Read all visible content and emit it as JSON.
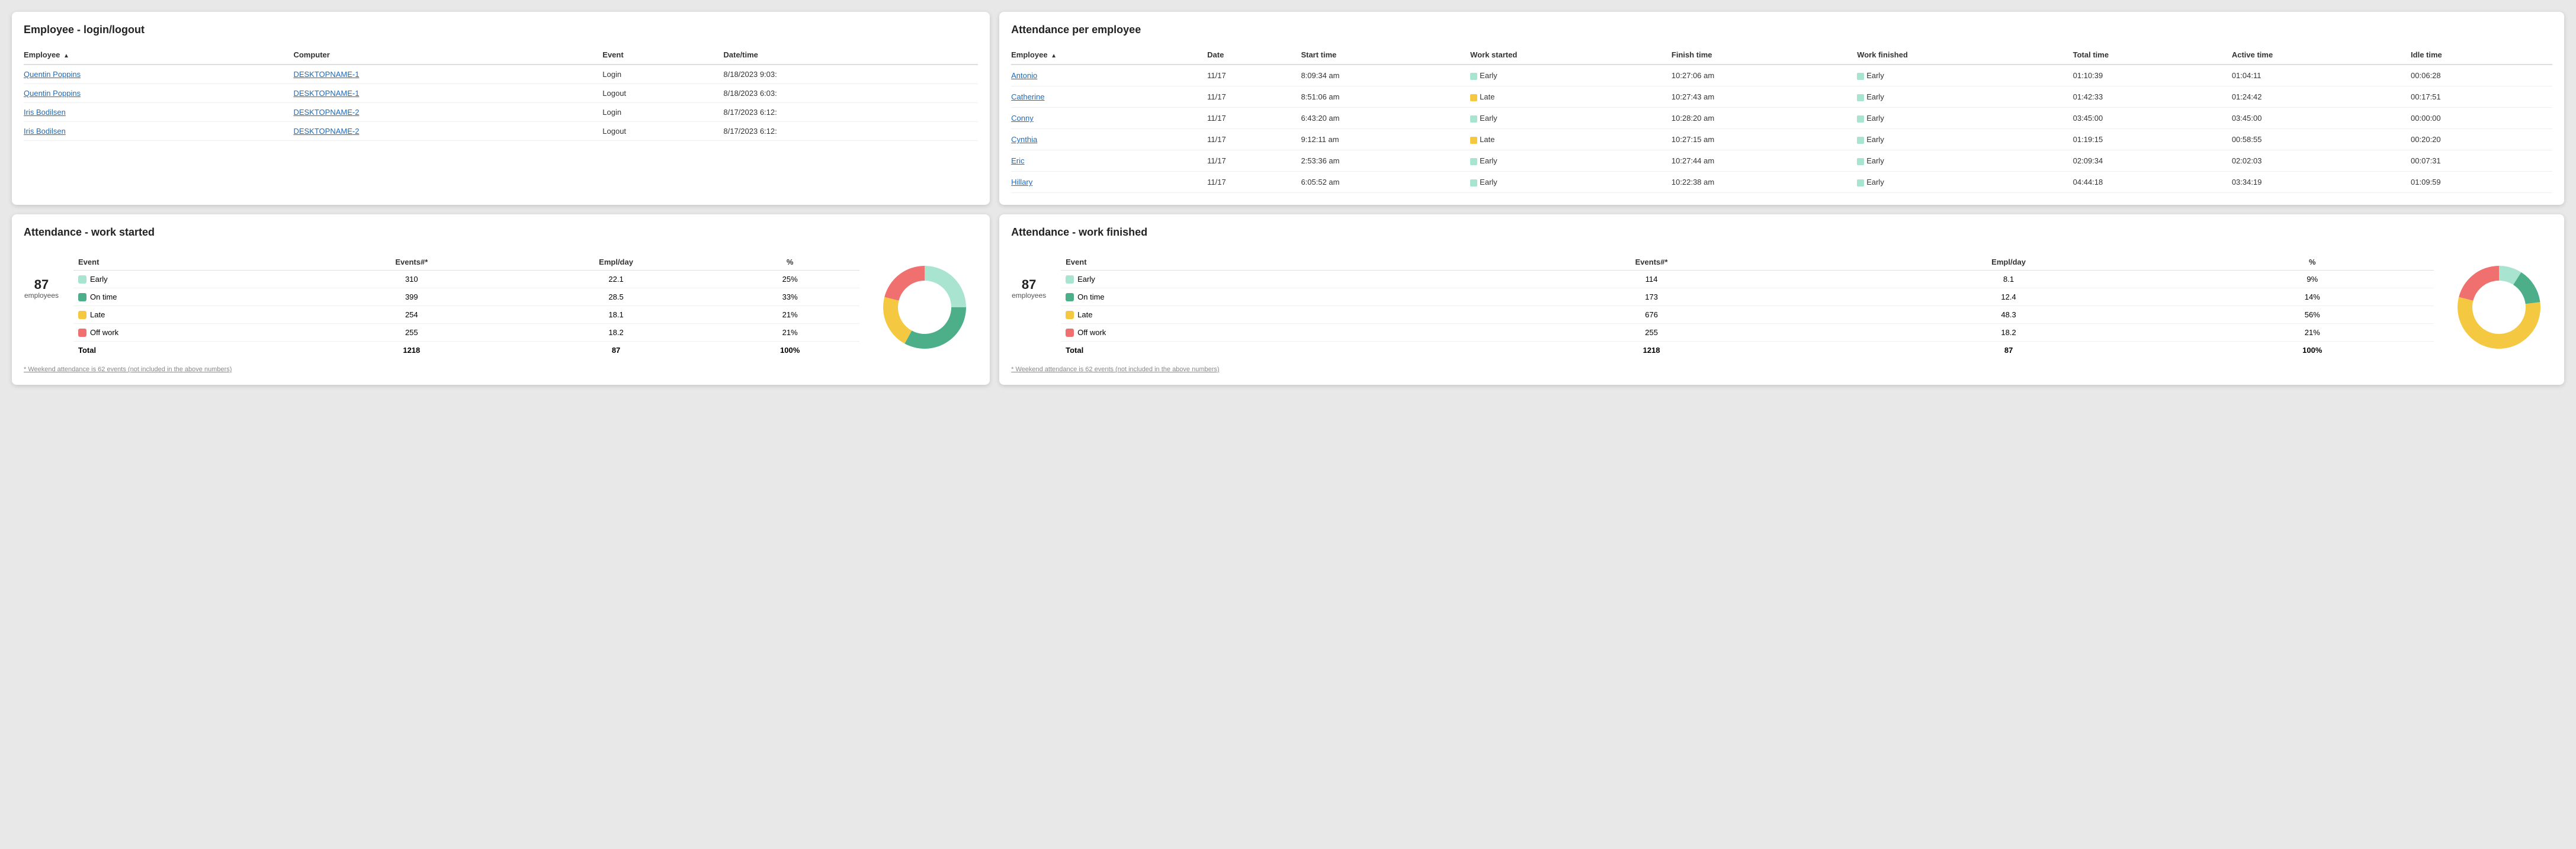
{
  "login_card": {
    "title": "Employee - login/logout",
    "columns": [
      "Employee",
      "Computer",
      "Event",
      "Date/time"
    ],
    "rows": [
      {
        "employee": "Quentin Poppins",
        "computer": "DESKTOPNAME-1",
        "event": "Login",
        "datetime": "8/18/2023 9:03:"
      },
      {
        "employee": "Quentin Poppins",
        "computer": "DESKTOPNAME-1",
        "event": "Logout",
        "datetime": "8/18/2023 6:03:"
      },
      {
        "employee": "Iris Bodilsen",
        "computer": "DESKTOPNAME-2",
        "event": "Login",
        "datetime": "8/17/2023 6:12:"
      },
      {
        "employee": "Iris Bodilsen",
        "computer": "DESKTOPNAME-2",
        "event": "Logout",
        "datetime": "8/17/2023 6:12:"
      }
    ]
  },
  "attendance_card": {
    "title": "Attendance per employee",
    "columns": [
      "Employee",
      "Date",
      "Start time",
      "Work started",
      "Finish time",
      "Work finished",
      "Total time",
      "Active time",
      "Idle time"
    ],
    "rows": [
      {
        "employee": "Antonio",
        "date": "11/17",
        "start_time": "8:09:34 am",
        "work_started": "Early",
        "work_started_dot": "early",
        "finish_time": "10:27:06 am",
        "work_finished": "Early",
        "work_finished_dot": "early",
        "total_time": "01:10:39",
        "active_time": "01:04:11",
        "idle_time": "00:06:28"
      },
      {
        "employee": "Catherine",
        "date": "11/17",
        "start_time": "8:51:06 am",
        "work_started": "Late",
        "work_started_dot": "late",
        "finish_time": "10:27:43 am",
        "work_finished": "Early",
        "work_finished_dot": "early",
        "total_time": "01:42:33",
        "active_time": "01:24:42",
        "idle_time": "00:17:51"
      },
      {
        "employee": "Conny",
        "date": "11/17",
        "start_time": "6:43:20 am",
        "work_started": "Early",
        "work_started_dot": "early",
        "finish_time": "10:28:20 am",
        "work_finished": "Early",
        "work_finished_dot": "early",
        "total_time": "03:45:00",
        "active_time": "03:45:00",
        "idle_time": "00:00:00"
      },
      {
        "employee": "Cynthia",
        "date": "11/17",
        "start_time": "9:12:11 am",
        "work_started": "Late",
        "work_started_dot": "late",
        "finish_time": "10:27:15 am",
        "work_finished": "Early",
        "work_finished_dot": "early",
        "total_time": "01:19:15",
        "active_time": "00:58:55",
        "idle_time": "00:20:20"
      },
      {
        "employee": "Eric",
        "date": "11/17",
        "start_time": "2:53:36 am",
        "work_started": "Early",
        "work_started_dot": "early",
        "finish_time": "10:27:44 am",
        "work_finished": "Early",
        "work_finished_dot": "early",
        "total_time": "02:09:34",
        "active_time": "02:02:03",
        "idle_time": "00:07:31"
      },
      {
        "employee": "Hillary",
        "date": "11/17",
        "start_time": "6:05:52 am",
        "work_started": "Early",
        "work_started_dot": "early",
        "finish_time": "10:22:38 am",
        "work_finished": "Early",
        "work_finished_dot": "early",
        "total_time": "04:44:18",
        "active_time": "03:34:19",
        "idle_time": "01:09:59"
      }
    ]
  },
  "work_started_panel": {
    "title": "Attendance - work started",
    "employees_count": "87",
    "employees_label": "employees",
    "columns": [
      "Event",
      "Events#*",
      "Empl/day",
      "%"
    ],
    "rows": [
      {
        "event": "Early",
        "color": "early-light",
        "events": "310",
        "empl_day": "22.1",
        "percent": "25%"
      },
      {
        "event": "On time",
        "color": "ontime",
        "events": "399",
        "empl_day": "28.5",
        "percent": "33%"
      },
      {
        "event": "Late",
        "color": "late",
        "events": "254",
        "empl_day": "18.1",
        "percent": "21%"
      },
      {
        "event": "Off work",
        "color": "offwork",
        "events": "255",
        "empl_day": "18.2",
        "percent": "21%"
      }
    ],
    "total_row": {
      "label": "Total",
      "events": "1218",
      "empl_day": "87",
      "percent": "100%"
    },
    "footnote": "* Weekend attendance is 62 events (not included in the above numbers)",
    "chart": {
      "segments": [
        {
          "label": "Early",
          "percent": 25,
          "color": "#a8e4d0"
        },
        {
          "label": "On time",
          "percent": 33,
          "color": "#4caf8a"
        },
        {
          "label": "Late",
          "percent": 21,
          "color": "#f5c842"
        },
        {
          "label": "Off work",
          "percent": 21,
          "color": "#f07070"
        }
      ]
    }
  },
  "work_finished_panel": {
    "title": "Attendance - work finished",
    "employees_count": "87",
    "employees_label": "employees",
    "columns": [
      "Event",
      "Events#*",
      "Empl/day",
      "%"
    ],
    "rows": [
      {
        "event": "Early",
        "color": "early-light",
        "events": "114",
        "empl_day": "8.1",
        "percent": "9%"
      },
      {
        "event": "On time",
        "color": "ontime",
        "events": "173",
        "empl_day": "12.4",
        "percent": "14%"
      },
      {
        "event": "Late",
        "color": "late",
        "events": "676",
        "empl_day": "48.3",
        "percent": "56%"
      },
      {
        "event": "Off work",
        "color": "offwork",
        "events": "255",
        "empl_day": "18.2",
        "percent": "21%"
      }
    ],
    "total_row": {
      "label": "Total",
      "events": "1218",
      "empl_day": "87",
      "percent": "100%"
    },
    "footnote": "* Weekend attendance is 62 events (not included in the above numbers)",
    "chart": {
      "segments": [
        {
          "label": "Early",
          "percent": 9,
          "color": "#a8e4d0"
        },
        {
          "label": "On time",
          "percent": 14,
          "color": "#4caf8a"
        },
        {
          "label": "Late",
          "percent": 56,
          "color": "#f5c842"
        },
        {
          "label": "Off work",
          "percent": 21,
          "color": "#f07070"
        }
      ]
    }
  }
}
